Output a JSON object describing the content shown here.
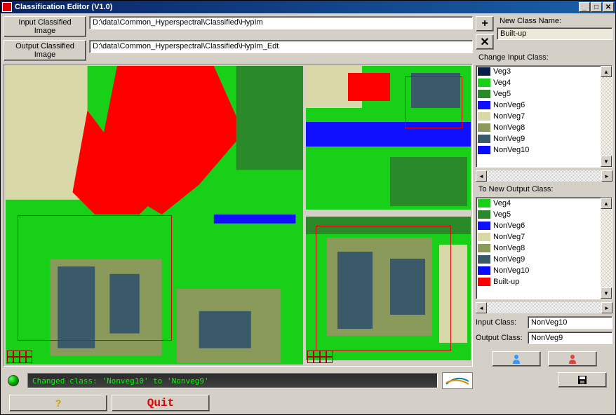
{
  "window": {
    "title": "Classification Editor (V1.0)"
  },
  "paths": {
    "input_label": "Input Classified Image",
    "input_value": "D:\\data\\Common_Hyperspectral\\Classified\\HypIm",
    "output_label": "Output Classified Image",
    "output_value": "D:\\data\\Common_Hyperspectral\\Classified\\HypIm_Edt"
  },
  "new_class": {
    "label": "New Class Name:",
    "value": "Built-up"
  },
  "input_classes": {
    "label": "Change Input Class:",
    "items": [
      {
        "name": "Veg3",
        "color": "#0b1e4a"
      },
      {
        "name": "Veg4",
        "color": "#18d018"
      },
      {
        "name": "Veg5",
        "color": "#2a8a2a"
      },
      {
        "name": "NonVeg6",
        "color": "#1010ff"
      },
      {
        "name": "NonVeg7",
        "color": "#d8d8a8"
      },
      {
        "name": "NonVeg8",
        "color": "#8a9a5b"
      },
      {
        "name": "NonVeg9",
        "color": "#3a5a6a"
      },
      {
        "name": "NonVeg10",
        "color": "#0a0aff"
      }
    ]
  },
  "output_classes": {
    "label": "To New Output Class:",
    "items": [
      {
        "name": "Veg4",
        "color": "#18d018"
      },
      {
        "name": "Veg5",
        "color": "#2a8a2a"
      },
      {
        "name": "NonVeg6",
        "color": "#1010ff"
      },
      {
        "name": "NonVeg7",
        "color": "#d8d8a8"
      },
      {
        "name": "NonVeg8",
        "color": "#8a9a5b"
      },
      {
        "name": "NonVeg9",
        "color": "#3a5a6a"
      },
      {
        "name": "NonVeg10",
        "color": "#0a0aff"
      },
      {
        "name": "Built-up",
        "color": "#ff0000"
      }
    ]
  },
  "fields": {
    "input_class_label": "Input Class:",
    "input_class_value": "NonVeg10",
    "output_class_label": "Output Class:",
    "output_class_value": "NonVeg9"
  },
  "status": {
    "text": "Changed class: 'Nonveg10' to 'Nonveg9'"
  },
  "buttons": {
    "help": "?",
    "quit": "Quit",
    "plus": "+",
    "minus": "✕"
  }
}
